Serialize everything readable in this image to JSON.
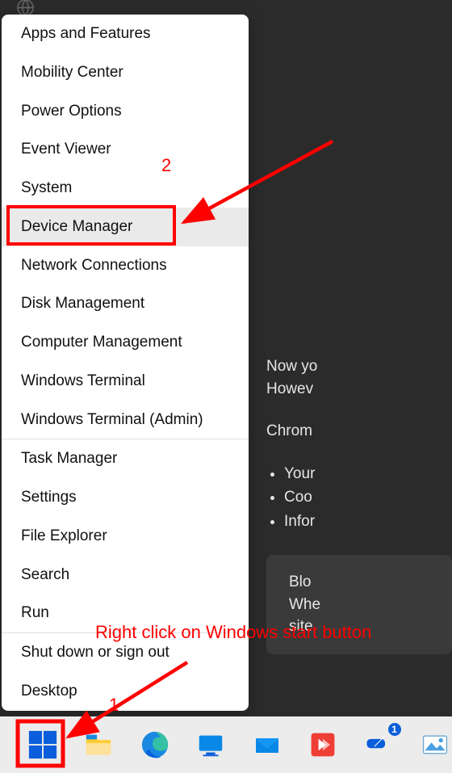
{
  "bg": {
    "para1_line1": "Now yo",
    "para1_line2": "Howev",
    "heading": "Chrom",
    "li1": "Your",
    "li2": "Coo",
    "li3": "Infor",
    "card_l1": "Blo",
    "card_l2": "Whe",
    "card_l3": "site"
  },
  "menu": {
    "apps_features": "Apps and Features",
    "mobility_center": "Mobility Center",
    "power_options": "Power Options",
    "event_viewer": "Event Viewer",
    "system": "System",
    "device_manager": "Device Manager",
    "network_connections": "Network Connections",
    "disk_management": "Disk Management",
    "computer_management": "Computer Management",
    "windows_terminal": "Windows Terminal",
    "windows_terminal_admin": "Windows Terminal (Admin)",
    "task_manager": "Task Manager",
    "settings": "Settings",
    "file_explorer": "File Explorer",
    "search": "Search",
    "run": "Run",
    "shut_down": "Shut down or sign out",
    "desktop": "Desktop"
  },
  "annotation": {
    "label2": "2",
    "label1": "1",
    "instruction": "Right click on Windows start button"
  },
  "taskbar_badge": "1"
}
